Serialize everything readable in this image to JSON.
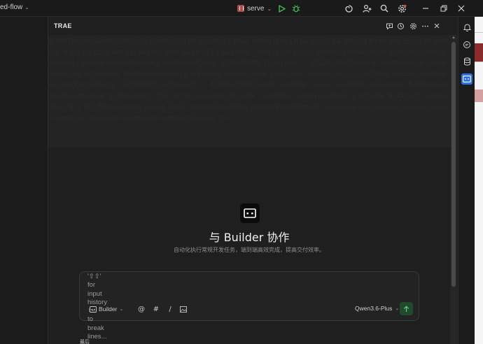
{
  "titlebar": {
    "project_name": "ed-flow",
    "run_config": "serve",
    "icons": [
      "chevron-down-icon",
      "run-icon",
      "debug-icon",
      "ai-spiral-icon",
      "add-user-icon",
      "search-icon",
      "settings-icon",
      "minimize-icon",
      "restore-icon",
      "close-icon"
    ]
  },
  "panel": {
    "title": "TRAE",
    "header_icons": [
      "new-chat-icon",
      "history-icon",
      "settings-icon",
      "more-icon",
      "close-icon"
    ],
    "inject_text": "globalThis.acquireVsCodeApi = (function() { let acquired = false; return () => { if (acquired && !false) { throw new Error('An instance of the VS Code API has already been acquired'); } acquired = true; return Object.freeze({ postMessage: function(message, transfer) { console.assert(!transfer); window.cefQuery_1131426803_1({request: '' + JSON.stringify({what: 'postMessage', value: message}),onSuccess: function(response) {},onFailure: function(error_code, error_message) {}}); }, setState: function(newState) { window.cefQuery_1131426803_1({request: '' + JSON.stringify({what: 'setState', value: newState}),onSuccess: function(response) {},onFailure: function(error_code, error_message) {}}); state = newState; return newState; }, getState: function() { return state; } }); }; })(); delete window.parent; delete window.top; delete window.frameElement;",
    "inject_text_small": " (function(){var t=document.body.getAttribute('codeverse-theme')||'dark';document.documentElement.setAttribute('data-theme',t);})();",
    "hero_title": "与 Builder 协作",
    "hero_subtitle": "自动化执行常规开发任务，端到端高效完成，提高交付效率。"
  },
  "chat_input": {
    "placeholder_lines": [
      "'⇧⇧'",
      "for",
      "input",
      "history",
      "⇧↵",
      "to",
      "break",
      "lines..."
    ],
    "mode_label": "Builder",
    "tools": [
      "@",
      "#",
      "/"
    ],
    "model": "Qwen3.6-Plus",
    "send_icon": "arrow-up-icon"
  },
  "bottom_text": "最后",
  "right_strip_icons": [
    "bell-icon",
    "chat-icon",
    "database-icon",
    "trae-panel-icon"
  ],
  "colors": {
    "background": "#1e1e1e",
    "accent_blue": "#2f6fdf",
    "run_green": "#3fb950",
    "send_green": "#1f4a2c"
  }
}
